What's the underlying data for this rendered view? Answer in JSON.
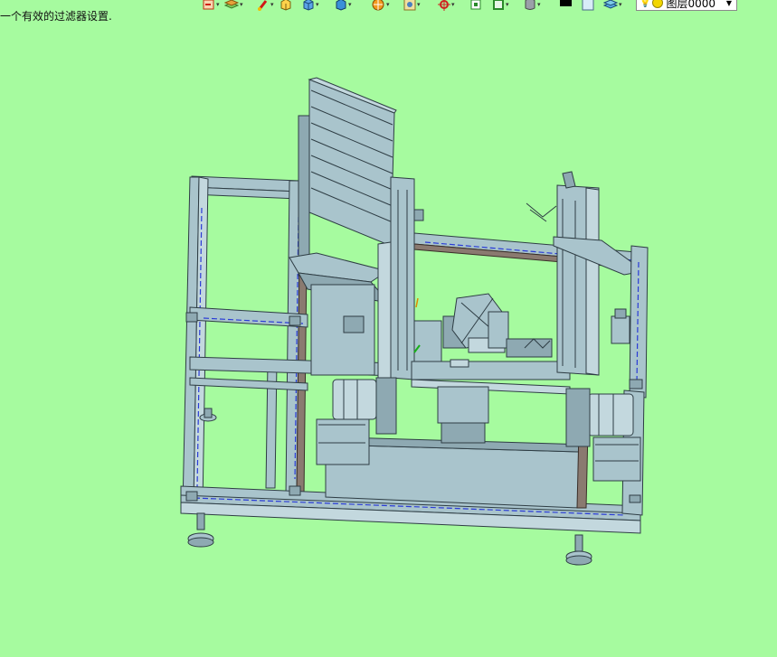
{
  "status": {
    "message": "一个有效的过滤器设置."
  },
  "toolbar": {
    "layer": {
      "label": "图层0000"
    }
  },
  "colors": {
    "viewport_bg": "#a6fb9f",
    "part_fill": "#a9c4cc",
    "part_stroke": "#2e3d44",
    "rail_blue": "#2a3bd6"
  }
}
